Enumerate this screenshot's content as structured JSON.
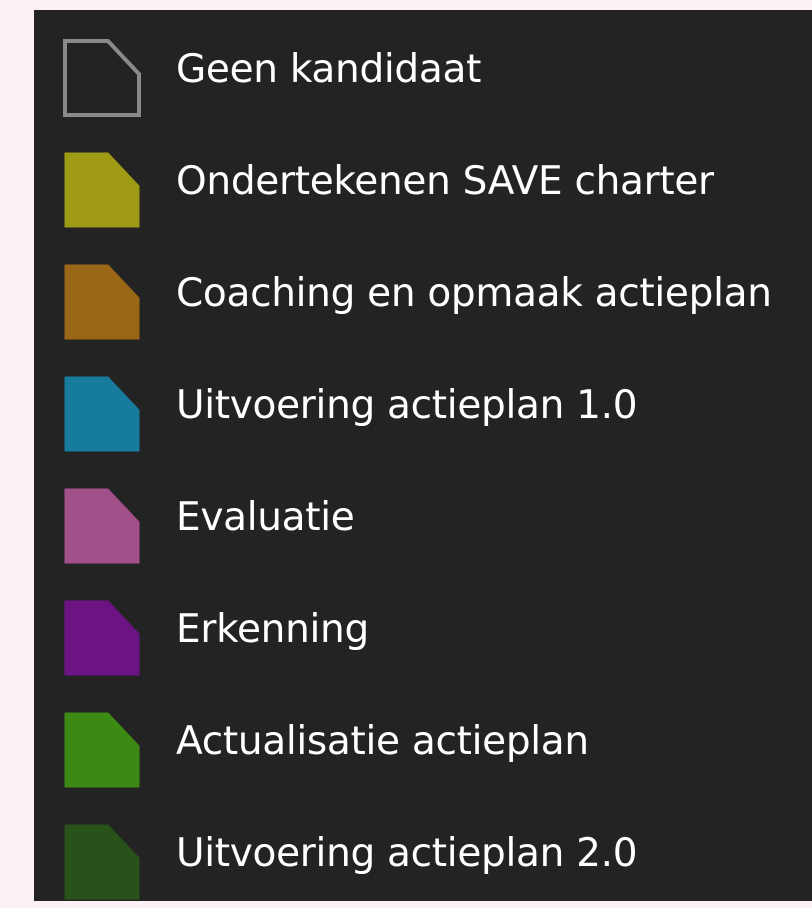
{
  "legend": {
    "items": [
      {
        "label": "Geen kandidaat",
        "fill": "none",
        "stroke": "#8a8a8a",
        "icon": "outline-shape-icon"
      },
      {
        "label": "Ondertekenen SAVE charter",
        "fill": "#9e9a14",
        "stroke": "#9e9a14",
        "icon": "swatch-icon"
      },
      {
        "label": "Coaching en opmaak actieplan",
        "fill": "#9a6716",
        "stroke": "#9a6716",
        "icon": "swatch-icon"
      },
      {
        "label": "Uitvoering actieplan 1.0",
        "fill": "#167b9c",
        "stroke": "#167b9c",
        "icon": "swatch-icon"
      },
      {
        "label": "Evaluatie",
        "fill": "#a24f8a",
        "stroke": "#a24f8a",
        "icon": "swatch-icon"
      },
      {
        "label": "Erkenning",
        "fill": "#6d1485",
        "stroke": "#6d1485",
        "icon": "swatch-icon"
      },
      {
        "label": "Actualisatie actieplan",
        "fill": "#3c8a14",
        "stroke": "#3c8a14",
        "icon": "swatch-icon"
      },
      {
        "label": "Uitvoering actieplan 2.0",
        "fill": "#28521a",
        "stroke": "#28521a",
        "icon": "swatch-icon"
      }
    ]
  }
}
